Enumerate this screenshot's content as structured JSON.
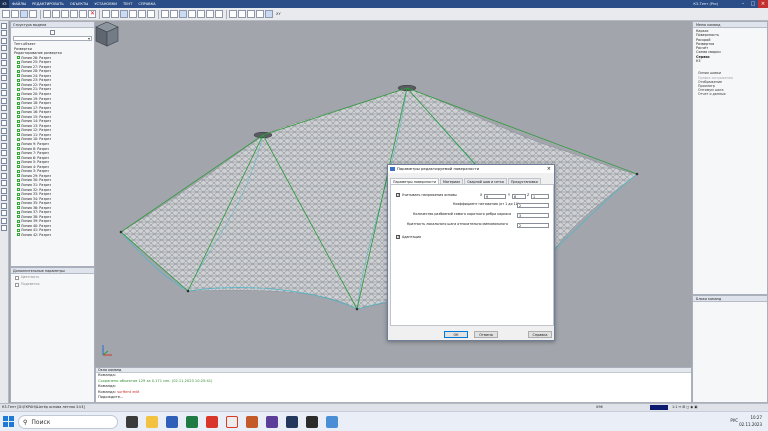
{
  "menubar": {
    "logo": "K3",
    "items": [
      "ФАЙЛЫ",
      "РЕДАКТИРОВАТЬ",
      "ОБЪЕКТЫ",
      "УСТАНОВКИ",
      "ТЕНТ",
      "СПРАВКА"
    ],
    "app_name": "К3-Тент (Pro)"
  },
  "toolbar": {
    "combo_value": "XY"
  },
  "tree_panel": {
    "title": "Структура модели",
    "items": [
      "Тент-объект",
      "Развертки",
      "Редактирование развертки",
      "Линия 26: Разрез",
      "Линия 25: Разрез",
      "Линия 27: Разрез",
      "Линия 28: Разрез",
      "Линия 24: Разрез",
      "Линия 23: Разрез",
      "Линия 22: Разрез",
      "Линия 21: Разрез",
      "Линия 20: Разрез",
      "Линия 19: Разрез",
      "Линия 18: Разрез",
      "Линия 17: Разрез",
      "Линия 16: Разрез",
      "Линия 15: Разрез",
      "Линия 14: Разрез",
      "Линия 13: Разрез",
      "Линия 12: Разрез",
      "Линия 11: Разрез",
      "Линия 10: Разрез",
      "Линия 9: Разрез",
      "Линия 8: Разрез",
      "Линия 7: Разрез",
      "Линия 6: Разрез",
      "Линия 5: Разрез",
      "Линия 4: Разрез",
      "Линия 3: Разрез",
      "Линия 29: Разрез",
      "Линия 30: Разрез",
      "Линия 31: Разрез",
      "Линия 32: Разрез",
      "Линия 33: Разрез",
      "Линия 34: Разрез",
      "Линия 35: Разрез",
      "Линия 36: Разрез",
      "Линия 37: Разрез",
      "Линия 38: Разрез",
      "Линия 39: Разрез",
      "Линия 40: Разрез",
      "Линия 41: Разрез",
      "Линия 42: Разрез"
    ]
  },
  "addprops_panel": {
    "title": "Дополнительные параметры",
    "rows": [
      "Цветность",
      "Подсветка"
    ]
  },
  "menu_panel": {
    "title": "Меню команд",
    "items": [
      "Каркас",
      "Поверхность",
      "Раскрой",
      "Развертка",
      "Расчёт",
      "Схема сварки",
      "Сервис",
      "К3"
    ],
    "active_index": 6,
    "commands": [
      {
        "label": "Линия шовки",
        "disabled": false
      },
      {
        "label": "Правка сопряжения",
        "disabled": true
      },
      {
        "label": "Отображение",
        "disabled": false
      },
      {
        "label": "Просмотр",
        "disabled": false
      },
      {
        "label": "Оптимум шага",
        "disabled": false
      },
      {
        "label": "Отчет о данных",
        "disabled": false
      }
    ]
  },
  "blocks_panel": {
    "title": "Блоки команд"
  },
  "command_window": {
    "title": "Окно команд",
    "lines": [
      "Команда:",
      "Сохранено объектов 129 за 0.171 сек. (02.11.2023 10:25:41)",
      "Команда:",
      "Команда: ",
      "Подождите..."
    ],
    "cmd_value": "surftent edit"
  },
  "statusbar": {
    "left": "К3-Тент  [D:\\ЕКРАН\\Шатёр основа летняя 3.k3]",
    "zoom": "X96",
    "icons": "1:1   ↔   ⊞   ◻  ◉  ▣"
  },
  "taskbar": {
    "search_placeholder": "Поиск",
    "lang": "РУС",
    "time": "10:27",
    "date": "02.11.2023"
  },
  "dialog": {
    "title": "Параметры редактируемой поверхности",
    "tabs": [
      "Параметры поверхности",
      "Материал",
      "Сварной шов и сетка",
      "Предустановки"
    ],
    "active_tab": 0,
    "tension_label": "Учитывать напряжения основы",
    "tension_x_label": "X",
    "tension_y_label": "Y",
    "tension_z_label": "Z",
    "tension_x": "9",
    "tension_y": "6",
    "tension_z": "1",
    "k_label": "Коэффициент натяжения (от 1 до 10)",
    "k_value": "2",
    "splits_label": "Количество разбиений самого короткого ребра каркаса",
    "splits_value": "3",
    "multiplicity_label": "Кратность локального шага относительно минимального",
    "multiplicity_value": "2",
    "adapt_label": "Адаптация",
    "ok": "ОК",
    "cancel": "Отмена",
    "help": "Справка"
  }
}
